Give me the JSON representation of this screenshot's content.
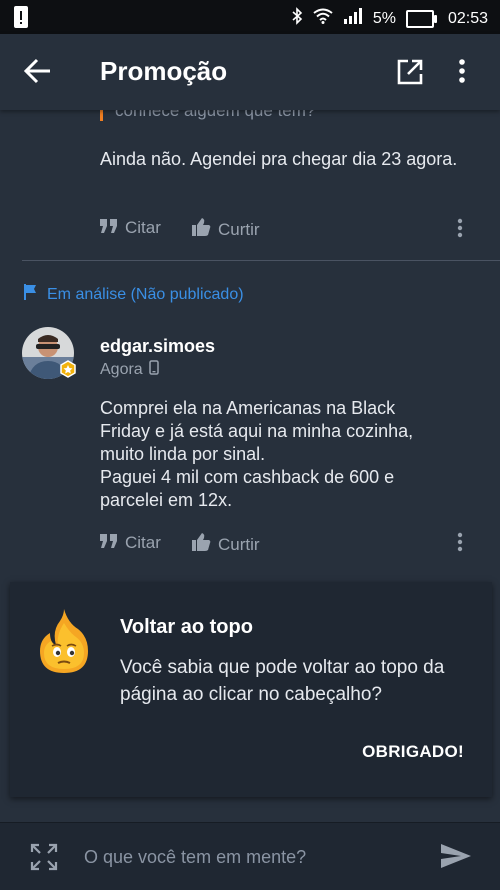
{
  "status_bar": {
    "battery": "5%",
    "time": "02:53"
  },
  "header": {
    "title": "Promoção"
  },
  "comment_prev": {
    "quote_fragment": "conhece alguém que tem?",
    "text": "Ainda não. Agendei pra chegar dia 23 agora.",
    "cite_label": "Citar",
    "like_label": "Curtir"
  },
  "review_status": "Em análise (Não publicado)",
  "comment": {
    "username": "edgar.simoes",
    "time": "Agora",
    "lines": [
      "Comprei ela na Americanas na Black",
      "Friday e já está aqui na minha cozinha,",
      "muito linda por sinal.",
      "Paguei 4 mil com cashback de 600 e",
      "parcelei em 12x."
    ],
    "cite_label": "Citar",
    "like_label": "Curtir"
  },
  "tip_card": {
    "title": "Voltar ao topo",
    "body": "Você sabia que pode voltar ao topo da página ao clicar no cabeçalho?",
    "button": "OBRIGADO!"
  },
  "composer": {
    "placeholder": "O que você tem em mente?"
  },
  "colors": {
    "background": "#27303c",
    "accent_blue": "#3a8fe5",
    "quote_orange": "#f07f22"
  }
}
